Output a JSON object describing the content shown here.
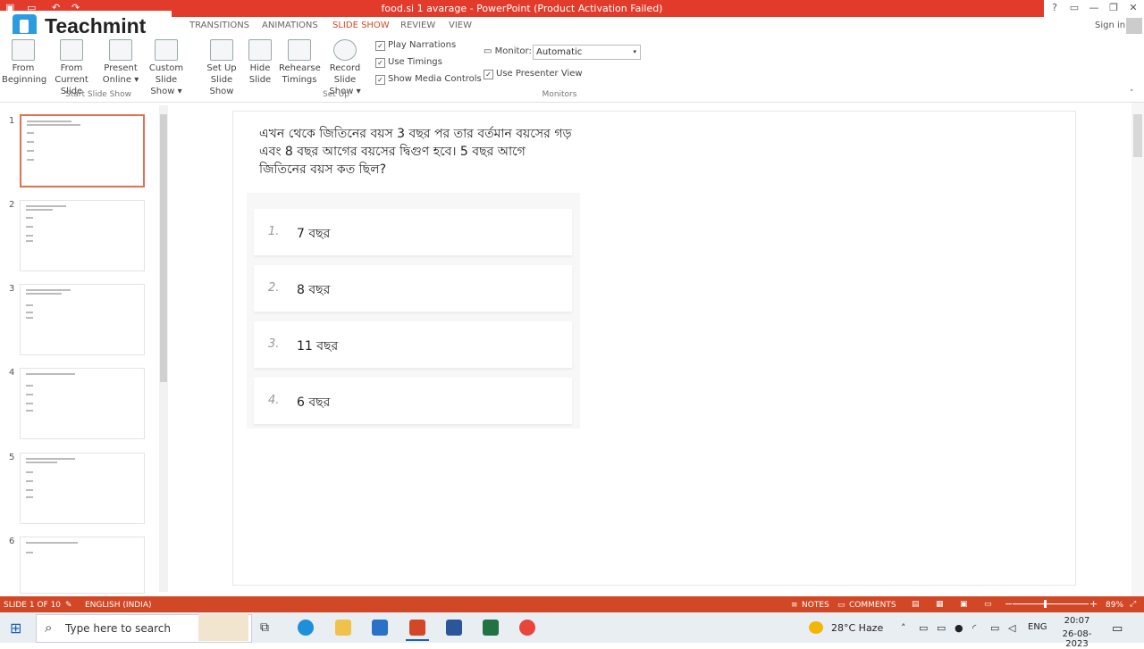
{
  "window": {
    "title": "food.si 1 avarage - PowerPoint (Product Activation Failed)",
    "controls": [
      "?",
      "▭",
      "—",
      "❐",
      "✕"
    ]
  },
  "logo": {
    "text": "Teachmint"
  },
  "tabs": [
    {
      "label": "TRANSITIONS",
      "active": false
    },
    {
      "label": "ANIMATIONS",
      "active": false
    },
    {
      "label": "SLIDE SHOW",
      "active": true
    },
    {
      "label": "REVIEW",
      "active": false
    },
    {
      "label": "VIEW",
      "active": false
    }
  ],
  "account": {
    "signin": "Sign in"
  },
  "ribbon": {
    "start_buttons": [
      {
        "line1": "From",
        "line2": "Beginning"
      },
      {
        "line1": "From",
        "line2": "Current Slide"
      },
      {
        "line1": "Present",
        "line2": "Online ▾"
      },
      {
        "line1": "Custom Slide",
        "line2": "Show ▾"
      }
    ],
    "setup_buttons": [
      {
        "line1": "Set Up",
        "line2": "Slide Show"
      },
      {
        "line1": "Hide",
        "line2": "Slide"
      },
      {
        "line1": "Rehearse",
        "line2": "Timings"
      },
      {
        "line1": "Record Slide",
        "line2": "Show ▾"
      }
    ],
    "checkboxes": [
      {
        "label": "Play Narrations",
        "checked": true
      },
      {
        "label": "Use Timings",
        "checked": true
      },
      {
        "label": "Show Media Controls",
        "checked": true
      }
    ],
    "monitor_label": "Monitor:",
    "monitor_value": "Automatic",
    "presenter_view": "Use Presenter View",
    "groups": [
      "Start Slide Show",
      "Set Up",
      "Monitors"
    ]
  },
  "thumbnails": [
    {
      "num": "1",
      "selected": true
    },
    {
      "num": "2",
      "selected": false
    },
    {
      "num": "3",
      "selected": false
    },
    {
      "num": "4",
      "selected": false
    },
    {
      "num": "5",
      "selected": false
    },
    {
      "num": "6",
      "selected": false
    }
  ],
  "slide": {
    "question": "এখন থেকে জিতিনের বয়স 3 বছর পর তার বর্তমান বয়সের গড় এবং 8 বছর আগের বয়সের দ্বিগুণ হবে। 5 বছর আগে জিতিনের বয়স কত ছিল?",
    "options": [
      {
        "num": "1.",
        "text": "7 বছর"
      },
      {
        "num": "2.",
        "text": "8 বছর"
      },
      {
        "num": "3.",
        "text": "11 বছর"
      },
      {
        "num": "4.",
        "text": "6 বছর"
      }
    ]
  },
  "status": {
    "slide": "SLIDE 1 OF 10",
    "language": "ENGLISH (INDIA)",
    "notes": "NOTES",
    "comments": "COMMENTS",
    "zoom": "89%"
  },
  "taskbar": {
    "search_placeholder": "Type here to search",
    "weather": "28°C  Haze",
    "lang": "ENG",
    "time": "20:07",
    "date": "26-08-2023"
  }
}
